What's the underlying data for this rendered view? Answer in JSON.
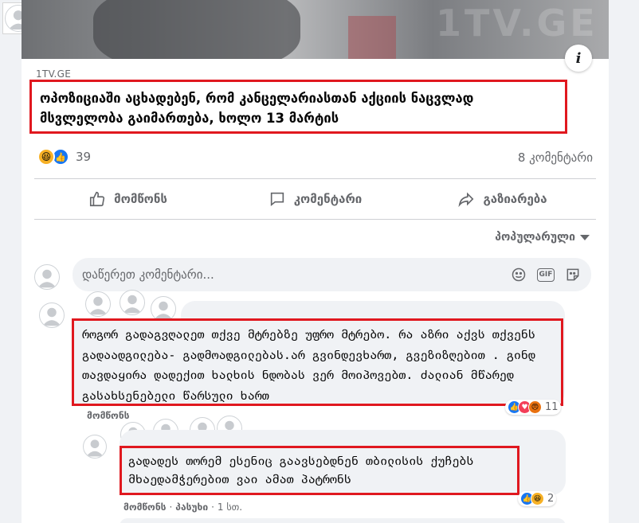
{
  "post": {
    "source": "1TV.GE",
    "headline": "ოპოზიციაში აცხადებენ, რომ კანცელარიასთან აქციის ნაცვლად მსვლელობა გაიმართება, ხოლო 13 მარტის",
    "info_label": "i",
    "reaction_count": "39",
    "comments_count": "8 კომენტარი",
    "reactions": [
      "haha-icon",
      "like-icon"
    ]
  },
  "actions": {
    "like": "მომწონს",
    "comment": "კომენტარი",
    "share": "გაზიარება"
  },
  "sort": {
    "label": "პოპულარული"
  },
  "composer": {
    "placeholder": "დაწერეთ კომენტარი..."
  },
  "comments": [
    {
      "text": "როგორ გადაგვღალეთ თქვე მტრებზე უფრო მტრებო. რა აზრი აქვს თქვენს გადაადგილება- გადმოადგილებას.არ გვინდევხართ, გვეზიზღებით . გინდ თავდაყირა დადექით ხალხის ნდობას ვერ მოიპოვებთ. ძალიან მწარედ გასახსენებელი წარსული ხართ",
      "meta": "მომწონს",
      "reaction_count": "11"
    }
  ],
  "reply": {
    "text": "გადადეს თორემ ესენიც გაავსებდნენ თბილისის ქუჩებს მხაედამჭერებით ვაი ამათ პატრონს",
    "like": "მომწონს",
    "separator": "·",
    "reply_label": "პასუხი",
    "time": "1 სთ.",
    "reaction_count": "2"
  },
  "colors": {
    "highlight_border": "#e0181f",
    "like_blue": "#1877f2",
    "haha_yellow": "#f7b125",
    "muted_text": "#65676b",
    "bubble_bg": "#f0f2f5"
  }
}
